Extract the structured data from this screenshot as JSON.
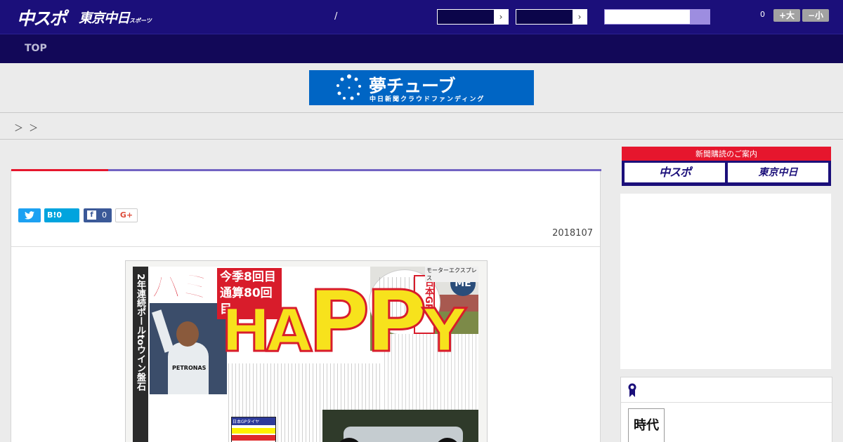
{
  "header": {
    "logo_chuspo": "中スポ",
    "logo_tokyo": "東京中日",
    "logo_tokyo_sub": "スポーツ",
    "slash": "/",
    "select1_arrow": "›",
    "select2_arrow": "›",
    "font_count": "0",
    "font_bigger": "+大",
    "font_smaller": "−小"
  },
  "nav": {
    "items": [
      {
        "label": "TOP"
      }
    ]
  },
  "banner": {
    "title": "夢チューブ",
    "subtitle": "中日新聞クラウドファンディング"
  },
  "breadcrumb": "＞ ＞",
  "article": {
    "share": {
      "twitter": "t",
      "hatena": "B!0",
      "facebook_icon": "f",
      "facebook_count": "0",
      "gplus": "G+"
    },
    "date": "2018107"
  },
  "newspaper": {
    "vertical_headline": "2年連続ポールtoウイン盤石",
    "hami": "ハミ",
    "record": "今季8回目 通算80回目",
    "happy_a": "HA",
    "happy_pp": "PP",
    "happy_y": "Y",
    "gp_box": "日本GP",
    "me_logo": "ME",
    "express": "モーターエクスプレス",
    "petronas": "PETRONAS",
    "tire_header": "日本GPタイヤ"
  },
  "sidebar": {
    "subscribe_label": "新聞購読のご案内",
    "btn_chuspo": "中スポ",
    "btn_tokyo": "東京中日",
    "thumb_text": "時代"
  },
  "colors": {
    "header_bg": "#1b0f7a",
    "nav_bg": "#120858",
    "accent_red": "#e6162d",
    "accent_purple": "#7264c2",
    "banner_blue": "#0065c4"
  }
}
